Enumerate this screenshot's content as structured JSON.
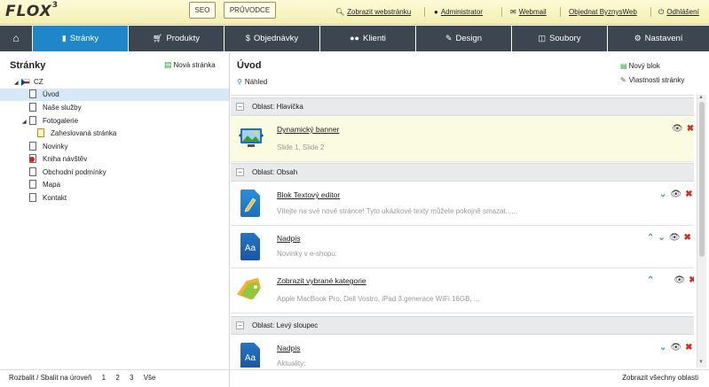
{
  "topbar": {
    "logo": "FLOX",
    "logo_version": "3",
    "seo_label": "SEO",
    "guide_label": "PRŮVODCE",
    "links": {
      "show_site": "Zobrazit webstránku",
      "admin": "Administrator",
      "webmail": "Webmail",
      "order": "Objednat ByznysWeb",
      "logout": "Odhlášení"
    }
  },
  "nav": {
    "items": [
      {
        "label": "",
        "icon": "home-icon"
      },
      {
        "label": "Stránky",
        "icon": "page-icon"
      },
      {
        "label": "Produkty",
        "icon": "cart-icon"
      },
      {
        "label": "Objednávky",
        "icon": "dollar-icon"
      },
      {
        "label": "Klienti",
        "icon": "users-icon"
      },
      {
        "label": "Design",
        "icon": "brush-icon"
      },
      {
        "label": "Soubory",
        "icon": "folder-icon"
      },
      {
        "label": "Nastavení",
        "icon": "gear-icon"
      }
    ],
    "active": "Stránky",
    "active_color": "#1f87c8",
    "bg_color": "#3b4651"
  },
  "left": {
    "title": "Stránky",
    "new_page": "Nová stránka",
    "tree": {
      "root": "CZ",
      "items": [
        "Úvod",
        "Naše služby",
        "Fotogalerie",
        "Zaheslovaná stránka",
        "Novinky",
        "Kniha návštěv",
        "Obchodní podmínky",
        "Mapa",
        "Kontakt"
      ]
    },
    "footer": {
      "label": "Rozbalit / Sbalit na úroveň",
      "levels": [
        "1",
        "2",
        "3",
        "Vše"
      ]
    }
  },
  "right": {
    "title": "Úvod",
    "preview": "Náhled",
    "new_block": "Nový blok",
    "block_props": "Vlastnosti stránky",
    "areas": [
      {
        "label": "Oblast: Hlavička"
      },
      {
        "label": "Oblast: Obsah"
      },
      {
        "label": "Oblast: Levý sloupec"
      }
    ],
    "blocks": [
      {
        "name": "Dynamický banner",
        "desc": "Slide 1, Slide 2",
        "icon": "banner-icon"
      },
      {
        "name": "Blok Textový editor",
        "desc": "Vítejte na své nové stránce! Tyto ukázkové texty můžete pokojně smazat......",
        "icon": "text-editor-icon"
      },
      {
        "name": "Nadpis",
        "desc": "Novinky v e-shopu:",
        "icon": "heading-icon",
        "icon_text": "Aa"
      },
      {
        "name": "Zobrazit vybrané kategorie",
        "desc": "Apple MacBook Pro, Dell Vostro, iPad 3.generace WiFi 16GB, ...",
        "icon": "tag-icon"
      },
      {
        "name": "Nadpis",
        "desc": "Aktuality:",
        "icon": "heading-icon",
        "icon_text": "Aa"
      }
    ],
    "footer": "Zobrazit všechny oblasti"
  }
}
